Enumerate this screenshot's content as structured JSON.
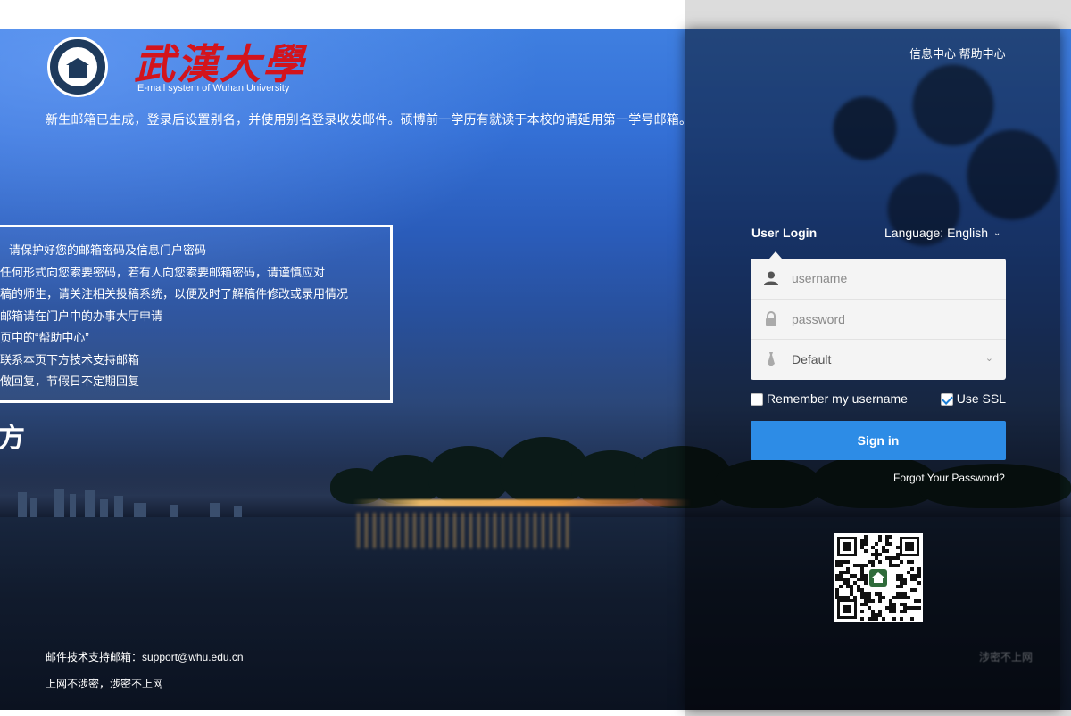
{
  "header": {
    "logo_title": "武漢大學",
    "logo_subtitle": "E-mail system of Wuhan University",
    "notice": "新生邮箱已生成，登录后设置别名，并使用别名登录收发邮件。硕博前一学历有就读于本校的请延用第一学号邮箱。"
  },
  "tips": {
    "items": [
      "请保护好您的邮箱密码及信息门户密码",
      "任何形式向您索要密码，若有人向您索要邮箱密码，请谨慎应对",
      "稿的师生，请关注相关投稿系统，以便及时了解稿件修改或录用情况",
      "邮箱请在门户中的办事大厅申请",
      "页中的“帮助中心”",
      "联系本页下方技术支持邮箱",
      "做回复，节假日不定期回复"
    ],
    "big_char": "方"
  },
  "footer": {
    "support": "邮件技术支持邮箱：support@whu.edu.cn",
    "motto": "上网不涉密，涉密不上网"
  },
  "top_links": {
    "info_center": "信息中心",
    "help_center": "帮助中心"
  },
  "login": {
    "title": "User Login",
    "language_label": "Language: English",
    "username_placeholder": "username",
    "password_placeholder": "password",
    "domain_value": "Default",
    "remember_label": "Remember my username",
    "remember_checked": false,
    "ssl_label": "Use SSL",
    "ssl_checked": true,
    "signin_label": "Sign in",
    "forgot_label": "Forgot Your Password?"
  },
  "watermark": "涉密不上网",
  "colors": {
    "brand_red": "#d3141c",
    "button_blue": "#2d8ce6",
    "seal_navy": "#1e3a5c"
  }
}
